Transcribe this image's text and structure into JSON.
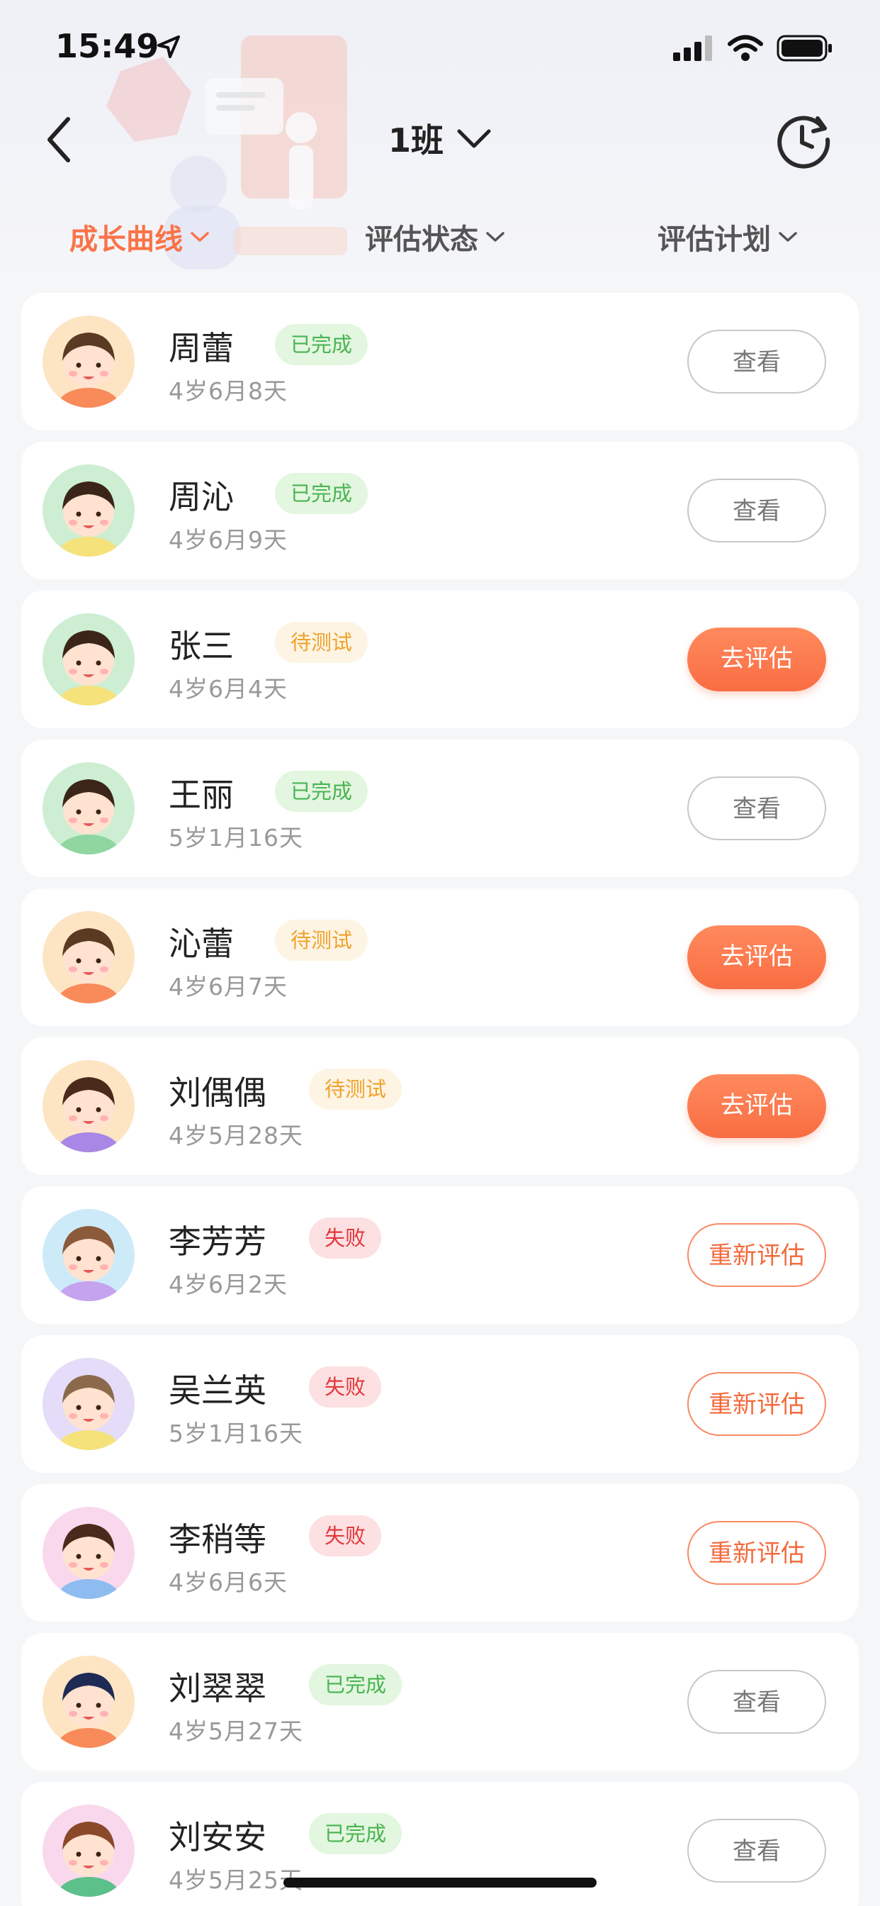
{
  "status_bar": {
    "time": "15:49"
  },
  "header": {
    "title": "1班"
  },
  "filters": [
    {
      "label": "成长曲线",
      "active": true
    },
    {
      "label": "评估状态",
      "active": false
    },
    {
      "label": "评估计划",
      "active": false
    }
  ],
  "students": [
    {
      "name": "周蕾",
      "badge": "已完成",
      "status": "done",
      "age": "4岁6月8天",
      "action": "查看",
      "avatar": {
        "bg": "#fde5c4",
        "hair": "#5a3a22",
        "shirt": "#f98a5a"
      }
    },
    {
      "name": "周沁",
      "badge": "已完成",
      "status": "done",
      "age": "4岁6月9天",
      "action": "查看",
      "avatar": {
        "bg": "#cdeed2",
        "hair": "#3b2418",
        "shirt": "#f6e27a"
      }
    },
    {
      "name": "张三",
      "badge": "待测试",
      "status": "pending",
      "age": "4岁6月4天",
      "action": "去评估",
      "avatar": {
        "bg": "#cdeed2",
        "hair": "#3b2418",
        "shirt": "#f6e27a"
      }
    },
    {
      "name": "王丽",
      "badge": "已完成",
      "status": "done",
      "age": "5岁1月16天",
      "action": "查看",
      "avatar": {
        "bg": "#cdeed2",
        "hair": "#3b2418",
        "shirt": "#8fd6a0"
      }
    },
    {
      "name": "沁蕾",
      "badge": "待测试",
      "status": "pending",
      "age": "4岁6月7天",
      "action": "去评估",
      "avatar": {
        "bg": "#fde5c4",
        "hair": "#5a3a22",
        "shirt": "#f98a5a"
      }
    },
    {
      "name": "刘偶偶",
      "badge": "待测试",
      "status": "pending",
      "age": "4岁5月28天",
      "action": "去评估",
      "avatar": {
        "bg": "#fde5c4",
        "hair": "#4a2a1a",
        "shirt": "#a987e6"
      }
    },
    {
      "name": "李芳芳",
      "badge": "失败",
      "status": "fail",
      "age": "4岁6月2天",
      "action": "重新评估",
      "avatar": {
        "bg": "#cdeaf8",
        "hair": "#8a5a3a",
        "shirt": "#c6a3ee"
      }
    },
    {
      "name": "吴兰英",
      "badge": "失败",
      "status": "fail",
      "age": "5岁1月16天",
      "action": "重新评估",
      "avatar": {
        "bg": "#e4dcf8",
        "hair": "#8a6a4a",
        "shirt": "#f6e27a"
      }
    },
    {
      "name": "李稍等",
      "badge": "失败",
      "status": "fail",
      "age": "4岁6月6天",
      "action": "重新评估",
      "avatar": {
        "bg": "#f9d8ee",
        "hair": "#4a2a1a",
        "shirt": "#8fbcf0"
      }
    },
    {
      "name": "刘翠翠",
      "badge": "已完成",
      "status": "done",
      "age": "4岁5月27天",
      "action": "查看",
      "avatar": {
        "bg": "#fde5c4",
        "hair": "#1f2a55",
        "shirt": "#f98a5a"
      }
    },
    {
      "name": "刘安安",
      "badge": "已完成",
      "status": "done",
      "age": "4岁5月25天",
      "action": "查看",
      "avatar": {
        "bg": "#f9d8ee",
        "hair": "#8a4a2a",
        "shirt": "#5cc08a"
      }
    }
  ]
}
